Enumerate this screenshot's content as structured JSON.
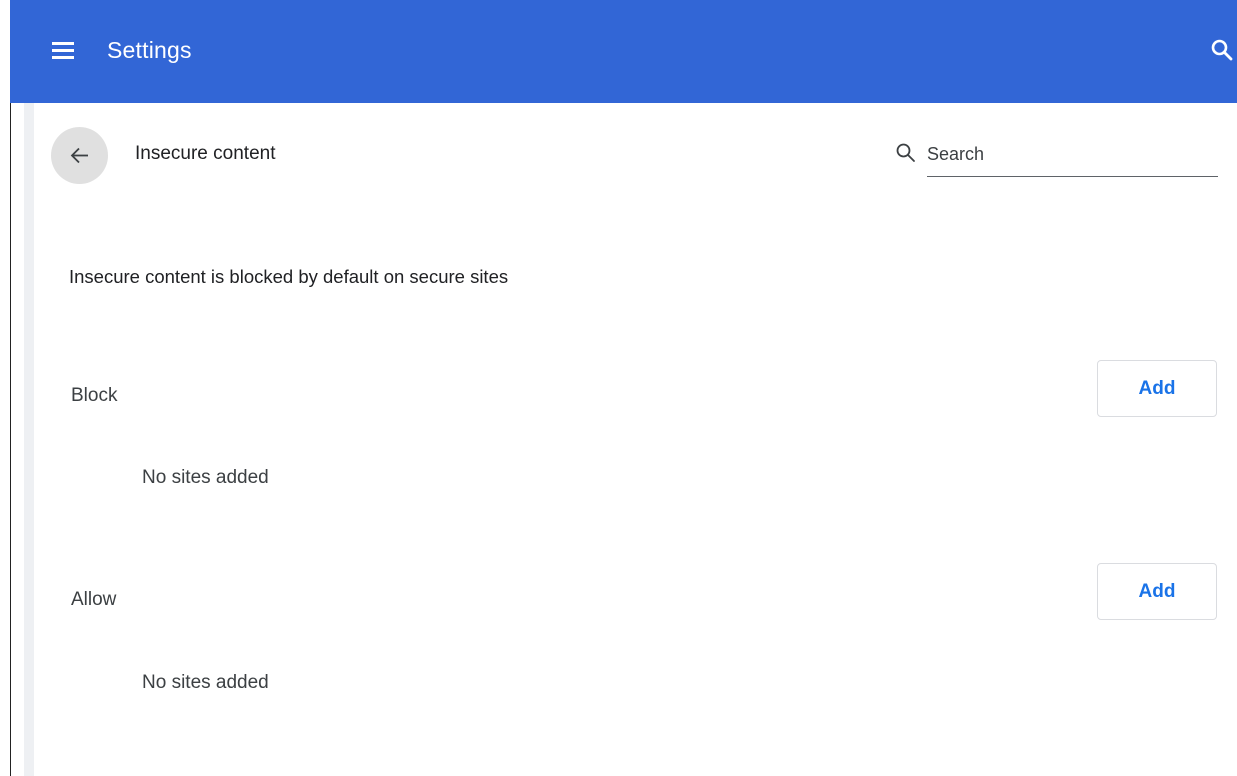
{
  "header": {
    "title": "Settings",
    "menu_icon": "hamburger-menu-icon",
    "search_icon": "search-icon",
    "bar_color": "#3266d6"
  },
  "subpage": {
    "back_icon": "arrow-back-icon",
    "title": "Insecure content",
    "search": {
      "placeholder": "Search",
      "value": ""
    }
  },
  "description": "Insecure content is blocked by default on secure sites",
  "sections": {
    "block": {
      "label": "Block",
      "add_label": "Add",
      "empty_text": "No sites added"
    },
    "allow": {
      "label": "Allow",
      "add_label": "Add",
      "empty_text": "No sites added"
    }
  },
  "colors": {
    "accent": "#1a73e8"
  }
}
